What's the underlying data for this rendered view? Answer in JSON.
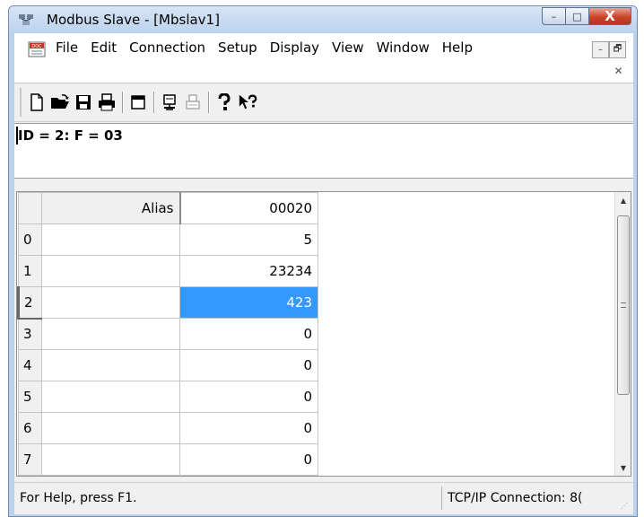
{
  "window": {
    "title": "Modbus Slave - [Mbslav1]",
    "controls": {
      "minimize": "–",
      "maximize": "□",
      "close": "X"
    }
  },
  "menu": {
    "items": [
      "File",
      "Edit",
      "Connection",
      "Setup",
      "Display",
      "View",
      "Window",
      "Help"
    ],
    "mdi": {
      "minimize": "–",
      "restore": "🗗",
      "close": "✕"
    }
  },
  "toolbar": {
    "icons": [
      "new-document-icon",
      "open-folder-icon",
      "save-disk-icon",
      "print-icon",
      "window-icon",
      "monitor-icon",
      "printer-disabled-icon",
      "help-question-icon",
      "context-help-icon"
    ]
  },
  "slave": {
    "id_line": "ID = 2: F = 03"
  },
  "grid": {
    "headers": {
      "alias": "Alias",
      "register": "00020"
    },
    "rows": [
      {
        "index": "0",
        "alias": "",
        "value": "5"
      },
      {
        "index": "1",
        "alias": "",
        "value": "23234"
      },
      {
        "index": "2",
        "alias": "",
        "value": "423"
      },
      {
        "index": "3",
        "alias": "",
        "value": "0"
      },
      {
        "index": "4",
        "alias": "",
        "value": "0"
      },
      {
        "index": "5",
        "alias": "",
        "value": "0"
      },
      {
        "index": "6",
        "alias": "",
        "value": "0"
      },
      {
        "index": "7",
        "alias": "",
        "value": "0"
      }
    ],
    "selected_row": 2
  },
  "status": {
    "help": "For Help, press F1.",
    "connection": "TCP/IP Connection: 8("
  },
  "colors": {
    "selection": "#3399ff",
    "close_button": "#c8452a",
    "frame": "#bcd2ec"
  }
}
